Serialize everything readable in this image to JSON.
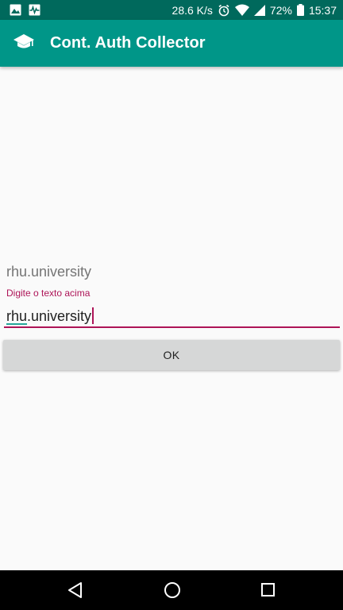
{
  "status_bar": {
    "network_speed": "28.6 K/s",
    "battery_percent": "72%",
    "time": "15:37",
    "icons": [
      "image-notification-icon",
      "activity-notification-icon",
      "alarm-icon",
      "wifi-icon",
      "signal-icon",
      "battery-icon"
    ]
  },
  "app_bar": {
    "title": "Cont. Auth Collector",
    "icon": "graduation-cap-icon"
  },
  "content": {
    "target_text": "rhu.university",
    "input_label": "Digite o texto acima",
    "input_prefix": "rhu",
    "input_suffix": ".university",
    "ok_label": "OK"
  },
  "nav_bar": {
    "buttons": [
      "back-icon",
      "home-icon",
      "recents-icon"
    ]
  },
  "colors": {
    "status_bar": "#00695c",
    "app_bar": "#009688",
    "accent": "#ad1457",
    "button": "#d6d7d7"
  }
}
